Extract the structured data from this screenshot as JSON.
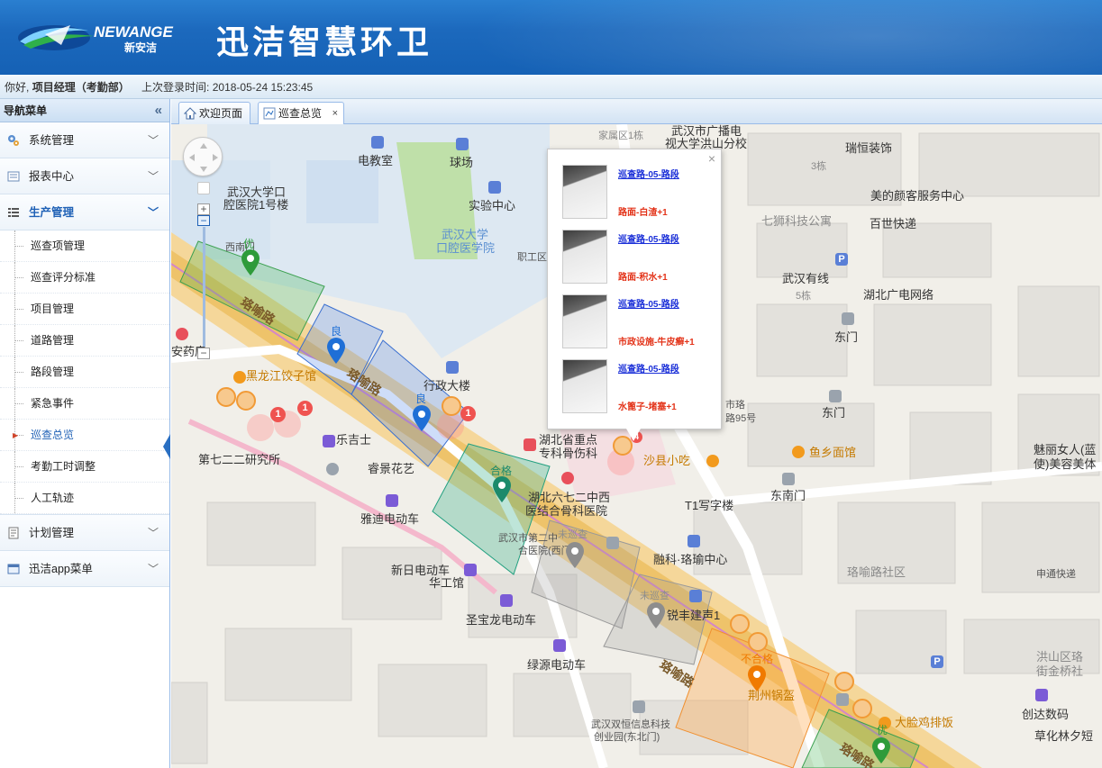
{
  "header": {
    "logo_text": "NEWANGE",
    "logo_sub": "新安洁",
    "app_title": "迅洁智慧环卫"
  },
  "userbar": {
    "greeting": "你好,",
    "user": "项目经理（考勤部）",
    "last_login_label": "上次登录时间:",
    "last_login_time": "2018-05-24 15:23:45"
  },
  "sidebar": {
    "title": "导航菜单",
    "collapse_icon": "double-chevron-left-icon",
    "groups": [
      {
        "label": "系统管理",
        "icon": "gear-icon"
      },
      {
        "label": "报表中心",
        "icon": "report-icon"
      },
      {
        "label": "生产管理",
        "icon": "list-icon"
      },
      {
        "label": "计划管理",
        "icon": "plan-icon"
      },
      {
        "label": "迅洁app菜单",
        "icon": "app-icon"
      }
    ],
    "production_items": [
      "巡查项管理",
      "巡查评分标准",
      "项目管理",
      "道路管理",
      "路段管理",
      "紧急事件",
      "巡查总览",
      "考勤工时调整",
      "人工轨迹"
    ],
    "active_item": "巡查总览"
  },
  "tabs": [
    {
      "label": "欢迎页面",
      "icon": "home-icon"
    },
    {
      "label": "巡查总览",
      "icon": "map-icon",
      "closable": true
    }
  ],
  "map": {
    "labels": {
      "dianjiaoshi": "电教室",
      "qiuchang": "球场",
      "shiyan": "实验中心",
      "kouqiang1": "武汉大学口",
      "kouqiang2": "腔医院1号楼",
      "wdkq1": "武汉大学",
      "wdkq2": "口腔医学院",
      "zhigong": "职工区",
      "xinan": "西南门",
      "luoyu1": "珞喻路",
      "luoyu2": "珞喻路",
      "luoyu3": "珞喻路",
      "luoyu4": "珞喻路",
      "luoyu_bottom": "珞喻路",
      "anyao": "安药房",
      "heilongjiang": "黑龙江饺子馆",
      "xingzheng": "行政大楼",
      "leshi": "乐吉士",
      "yanjiusuo": "第七二二研究所",
      "ruijing": "睿景花艺",
      "yadi": "雅迪电动车",
      "xinri": "新日电动车",
      "huagong": "华工馆",
      "shengbao": "圣宝龙电动车",
      "lvyuan": "绿源电动车",
      "hubei1": "湖北省重点",
      "hubei2": "专科骨伤科",
      "hubei3": "湖北六七二中西",
      "hubei4": "医结合骨科医院",
      "wuhanshi1": "武汉市第二中",
      "wuhanshi2": "合医院(西门)",
      "shaxian": "沙县小吃",
      "yuxiang": "鱼乡面馆",
      "t1": "T1写字楼",
      "dongnan": "东南门",
      "dongmen": "东门",
      "dongmen2": "东门",
      "rongke": "融科·珞瑜中心",
      "ruifeng": "锐丰建声1",
      "luoyushequ": "珞喻路社区",
      "shenxun": "申通快递",
      "guangbo1": "武汉市广播电",
      "guangbo2": "视大学洪山分校",
      "ruiheng": "瑞恒装饰",
      "meiyan": "美的颜客服务中心",
      "baishi": "百世快递",
      "qishen": "七狮科技公寓",
      "youxian": "武汉有线",
      "guangdian": "湖北广电网络",
      "meili1": "魅丽女人(蓝",
      "meili2": "使)美容美体",
      "hongshan1": "洪山区珞",
      "hongshan2": "街金桥社",
      "jingzhou": "荆州锅盔",
      "dalian": "大脸鸡排饭",
      "chuangda": "创达数码",
      "caohua": "草化林夕短",
      "shuangheng1": "武汉双恒信息科技",
      "shuangheng2": "创业园(东北门)",
      "jiashu": "家属区1栋",
      "b3": "3栋",
      "b5": "5栋",
      "shibu": "市珞",
      "shibu2": "路95号"
    },
    "grades": {
      "liang1": "良",
      "liang2": "良",
      "hege": "合格",
      "weixuncha1": "未巡查",
      "weixuncha2": "未巡查",
      "buhege": "不合格",
      "you1": "优",
      "you2": "优"
    },
    "badges": [
      "1",
      "1",
      "1",
      "4"
    ],
    "popup": {
      "close": "×",
      "items": [
        {
          "title": "巡查路-05-路段",
          "issue": "路面-白渣+1"
        },
        {
          "title": "巡查路-05-路段",
          "issue": "路面-积水+1"
        },
        {
          "title": "巡查路-05-路段",
          "issue": "市政设施-牛皮癣+1"
        },
        {
          "title": "巡查路-05-路段",
          "issue": "水篦子-堵塞+1"
        }
      ]
    },
    "zoom_in": "+",
    "zoom_out": "−",
    "status_colors": {
      "you": "#2e9b3a",
      "liang": "#1f6fd6",
      "hege": "#1c8a6b",
      "weixuncha": "#8d8d8d",
      "buhege": "#f07a00"
    }
  }
}
